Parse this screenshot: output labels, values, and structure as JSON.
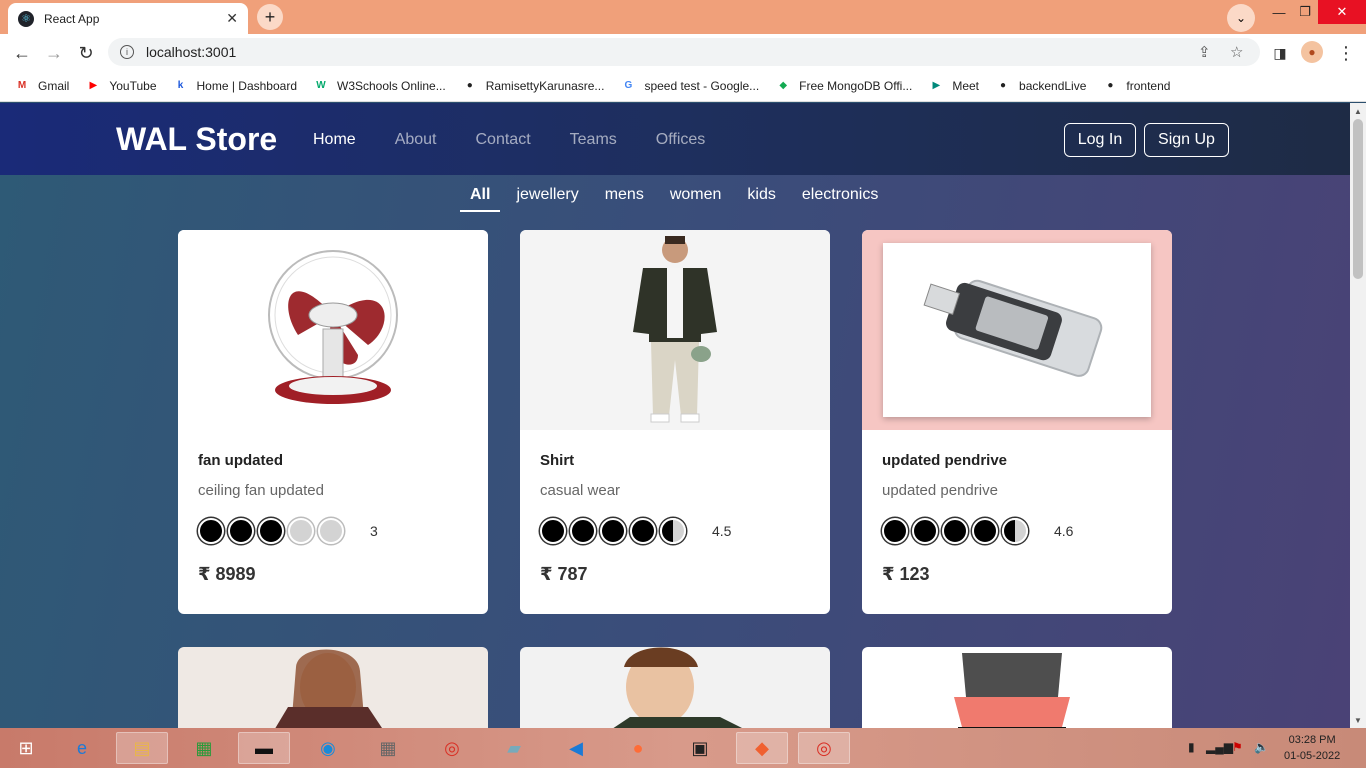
{
  "browser": {
    "tab_title": "React App",
    "url": "localhost:3001",
    "bookmarks": [
      {
        "label": "Gmail",
        "icon": "gmail-icon",
        "color": "#d93025"
      },
      {
        "label": "YouTube",
        "icon": "youtube-icon",
        "color": "#ff0000"
      },
      {
        "label": "Home | Dashboard",
        "icon": "k-icon",
        "color": "#1a56db"
      },
      {
        "label": "W3Schools Online...",
        "icon": "w3schools-icon",
        "color": "#04aa6d"
      },
      {
        "label": "RamisettyKarunasre...",
        "icon": "github-icon",
        "color": "#222"
      },
      {
        "label": "speed test - Google...",
        "icon": "google-icon",
        "color": "#4285f4"
      },
      {
        "label": "Free MongoDB Offi...",
        "icon": "mongodb-icon",
        "color": "#13aa52"
      },
      {
        "label": "Meet",
        "icon": "meet-icon",
        "color": "#00897b"
      },
      {
        "label": "backendLive",
        "icon": "github-icon",
        "color": "#222"
      },
      {
        "label": "frontend",
        "icon": "github-icon",
        "color": "#222"
      }
    ]
  },
  "nav": {
    "brand": "WAL Store",
    "links": [
      "Home",
      "About",
      "Contact",
      "Teams",
      "Offices"
    ],
    "login": "Log In",
    "signup": "Sign Up"
  },
  "categories": [
    "All",
    "jewellery",
    "mens",
    "women",
    "kids",
    "electronics"
  ],
  "products": [
    {
      "title": "fan updated",
      "description": "ceiling fan updated",
      "rating": 3,
      "rating_label": "3",
      "price": "₹ 8989",
      "image": "table-fan"
    },
    {
      "title": "Shirt",
      "description": "casual wear",
      "rating": 4.5,
      "rating_label": "4.5",
      "price": "₹ 787",
      "image": "man-jacket"
    },
    {
      "title": "updated pendrive",
      "description": "updated pendrive",
      "rating": 4.6,
      "rating_label": "4.6",
      "price": "₹ 123",
      "image": "pendrive"
    }
  ],
  "taskbar": {
    "time": "03:28 PM",
    "date": "01-05-2022"
  }
}
